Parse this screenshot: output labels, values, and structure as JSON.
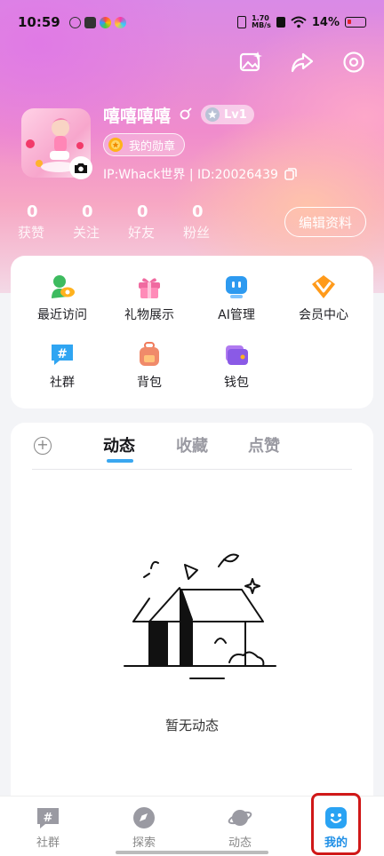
{
  "status": {
    "time": "10:59",
    "net": "1.70\nMB/s",
    "battery": "14%"
  },
  "profile": {
    "name": "嘻嘻嘻嘻",
    "level": "Lv1",
    "medal": "我的勋章",
    "ip": "IP:Whack世界 | ID:20026439",
    "edit": "编辑资料"
  },
  "stats": [
    {
      "n": "0",
      "l": "获赞"
    },
    {
      "n": "0",
      "l": "关注"
    },
    {
      "n": "0",
      "l": "好友"
    },
    {
      "n": "0",
      "l": "粉丝"
    }
  ],
  "grid": [
    "最近访问",
    "礼物展示",
    "AI管理",
    "会员中心",
    "社群",
    "背包",
    "钱包"
  ],
  "tabs": [
    "动态",
    "收藏",
    "点赞"
  ],
  "empty": "暂无动态",
  "nav": [
    "社群",
    "探索",
    "动态",
    "我的"
  ],
  "colors": {
    "accent": "#1f8fe6",
    "highlight": "#d01818"
  }
}
